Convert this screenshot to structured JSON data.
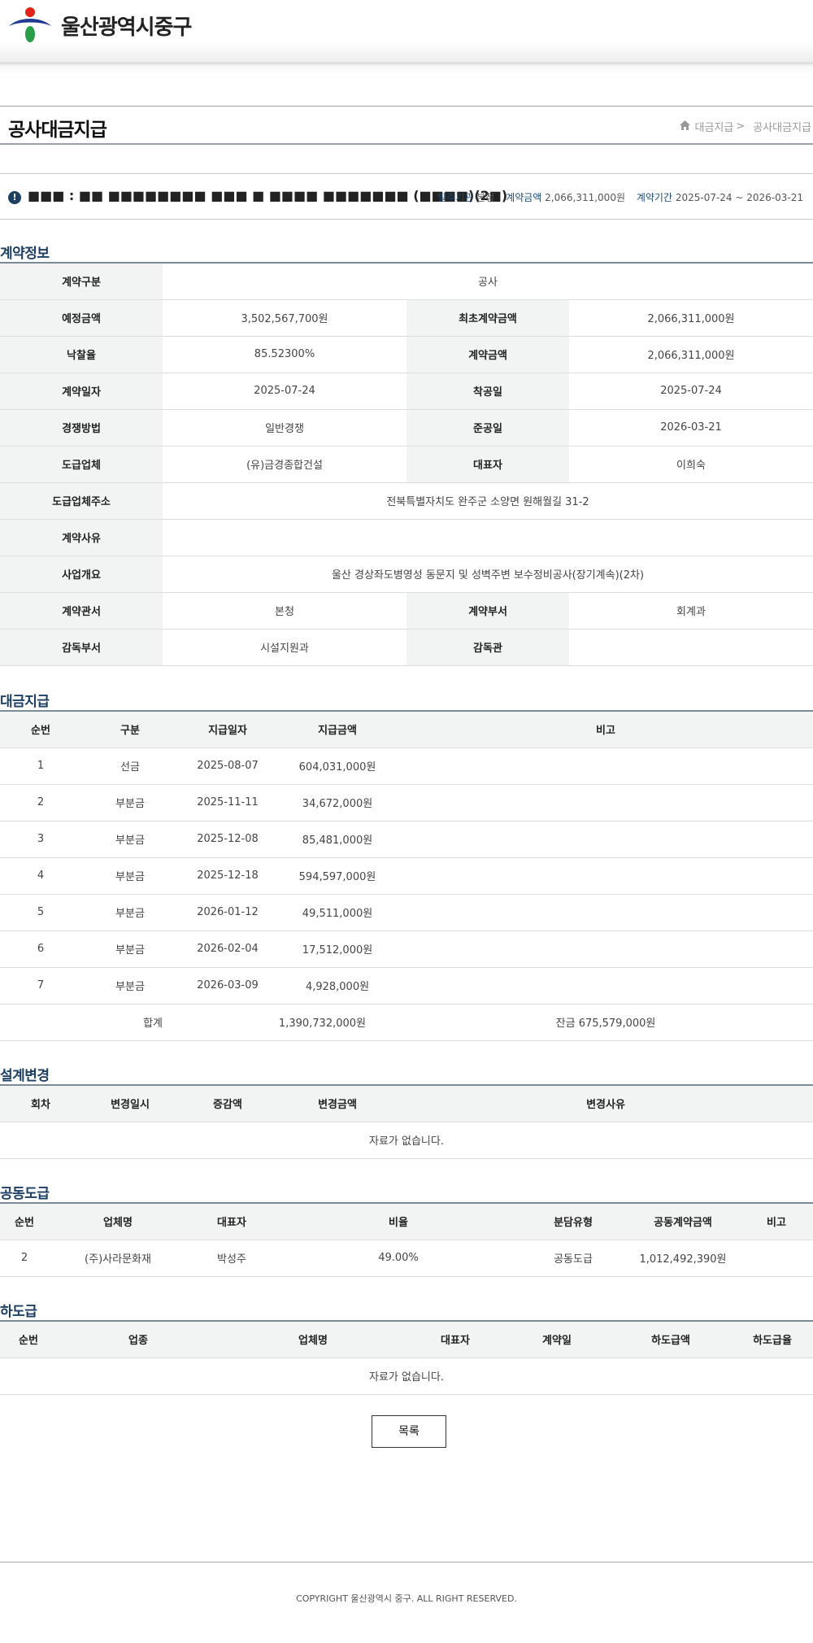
{
  "header": {
    "logo_text": "울산광역시중구"
  },
  "page": {
    "title": "공사대금지급",
    "breadcrumb": [
      "대금지급",
      "공사대금지급"
    ]
  },
  "summary": {
    "title": "■■■ : ■■ ■■■■■■■■ ■■■ ■ ■■■■ ■■■■■■■ (■■■■)(2■)",
    "order_org_label": "발주기관",
    "order_org_value": "본청",
    "contract_amount_label": "계약금액",
    "contract_amount_value": "2,066,311,000원",
    "contract_period_label": "계약기간",
    "contract_period_value": "2025-07-24 ~ 2026-03-21"
  },
  "contract_info": {
    "heading": "계약정보",
    "contract_type_label": "계약구분",
    "contract_type": "공사",
    "estimated_amount_label": "예정금액",
    "estimated_amount": "3,502,567,700원",
    "initial_amount_label": "최초계약금액",
    "initial_amount": "2,066,311,000원",
    "bid_rate_label": "낙찰율",
    "bid_rate": "85.52300%",
    "contract_amount_label": "계약금액",
    "contract_amount": "2,066,311,000원",
    "contract_date_label": "계약일자",
    "contract_date": "2025-07-24",
    "start_date_label": "착공일",
    "start_date": "2025-07-24",
    "competition_label": "경쟁방법",
    "competition": "일반경쟁",
    "completion_date_label": "준공일",
    "completion_date": "2026-03-21",
    "contractor_label": "도급업체",
    "contractor": "(유)금경종합건설",
    "representative_label": "대표자",
    "representative": "이희숙",
    "contractor_address_label": "도급업체주소",
    "contractor_address": "전북특별자치도 완주군 소양면 원해월길 31-2",
    "reason_label": "계약사유",
    "reason": "",
    "overview_label": "사업개요",
    "overview": "울산 경상좌도병영성 동문지 및 성벽주변 보수정비공사(장기계속)(2차)",
    "office_label": "계약관서",
    "office": "본청",
    "department_label": "계약부서",
    "department": "회계과",
    "supervising_dept_label": "감독부서",
    "supervising_dept": "시설지원과",
    "supervisor_label": "감독관",
    "supervisor": ""
  },
  "payments": {
    "heading": "대금지급",
    "columns": [
      "순번",
      "구분",
      "지급일자",
      "지급금액",
      "비고"
    ],
    "rows": [
      [
        "1",
        "선금",
        "2025-08-07",
        "604,031,000원",
        ""
      ],
      [
        "2",
        "부분금",
        "2025-11-11",
        "34,672,000원",
        ""
      ],
      [
        "3",
        "부분금",
        "2025-12-08",
        "85,481,000원",
        ""
      ],
      [
        "4",
        "부분금",
        "2025-12-18",
        "594,597,000원",
        ""
      ],
      [
        "5",
        "부분금",
        "2026-01-12",
        "49,511,000원",
        ""
      ],
      [
        "6",
        "부분금",
        "2026-02-04",
        "17,512,000원",
        ""
      ],
      [
        "7",
        "부분금",
        "2026-03-09",
        "4,928,000원",
        ""
      ]
    ],
    "total_label": "합계",
    "total_value": "1,390,732,000원",
    "balance": "잔금 675,579,000원"
  },
  "design_change": {
    "heading": "설계변경",
    "columns": [
      "회차",
      "변경일시",
      "증감액",
      "변경금액",
      "변경사유"
    ],
    "empty": "자료가 없습니다."
  },
  "joint": {
    "heading": "공동도급",
    "columns": [
      "순번",
      "업체명",
      "대표자",
      "비율",
      "분담유형",
      "공동계약금액",
      "비고"
    ],
    "rows": [
      [
        "2",
        "(주)사라문화재",
        "박성주",
        "49.00%",
        "공동도급",
        "1,012,492,390원",
        ""
      ]
    ]
  },
  "subcontract": {
    "heading": "하도급",
    "columns": [
      "순번",
      "업종",
      "업체명",
      "대표자",
      "계약일",
      "하도급액",
      "하도급율"
    ],
    "empty": "자료가 없습니다."
  },
  "buttons": {
    "list_label": "목록"
  },
  "footer": {
    "copyright": "COPYRIGHT   울산광역시 중구. ALL RIGHT RESERVED."
  }
}
